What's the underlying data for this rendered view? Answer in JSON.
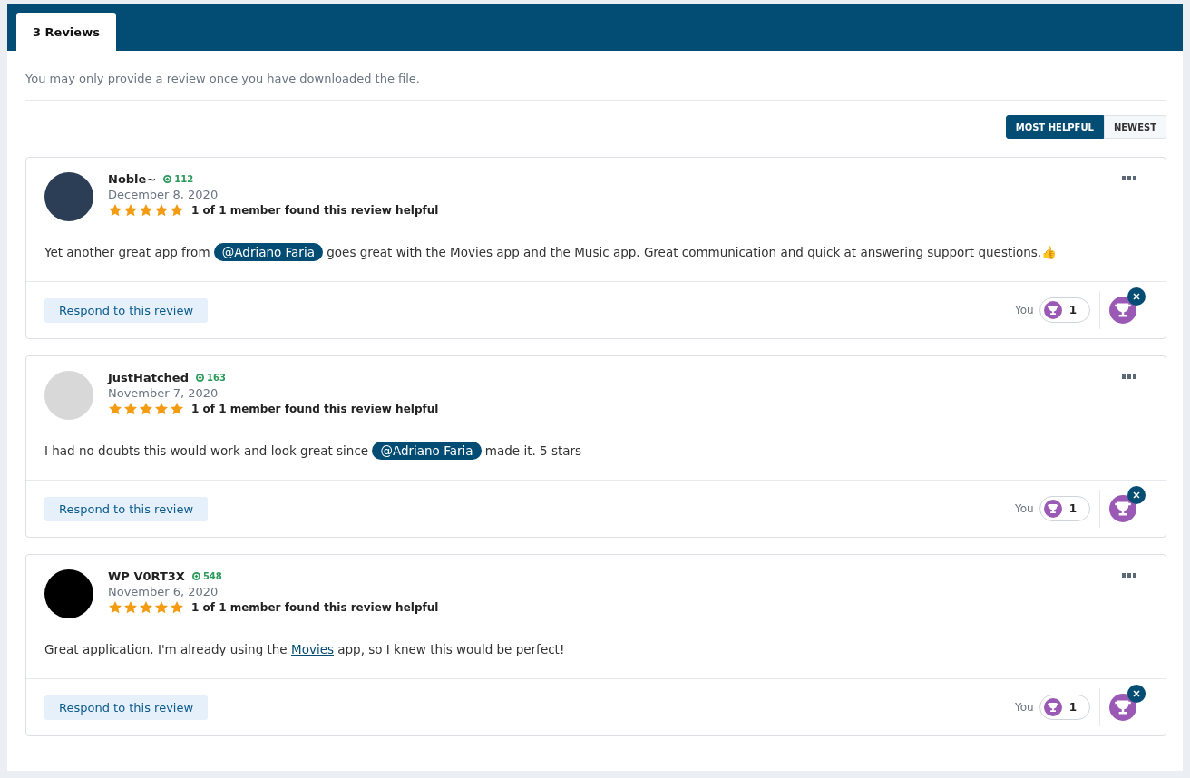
{
  "tabs": [
    {
      "label": "3 Reviews",
      "selected": true
    }
  ],
  "notice": "You may only provide a review once you have downloaded the file.",
  "sort": [
    {
      "label": "MOST HELPFUL",
      "selected": true
    },
    {
      "label": "NEWEST",
      "selected": false
    }
  ],
  "reviews": [
    {
      "author": "Noble~",
      "reputation": "112",
      "date": "December 8, 2020",
      "stars": 5,
      "helpful": "1 of 1 member found this review helpful",
      "body": [
        {
          "kind": "text",
          "text": "Yet another great app from "
        },
        {
          "kind": "mention",
          "text": "@Adriano Faria"
        },
        {
          "kind": "text",
          "text": " goes great with the Movies app and the Music app. Great communication and quick at answering support questions.👍"
        }
      ],
      "respond": "Respond to this review",
      "reactor": "You",
      "reaction_count": "1"
    },
    {
      "author": "JustHatched",
      "reputation": "163",
      "date": "November 7, 2020",
      "stars": 5,
      "helpful": "1 of 1 member found this review helpful",
      "body": [
        {
          "kind": "text",
          "text": "I had no doubts this would work and look great since "
        },
        {
          "kind": "mention",
          "text": "@Adriano Faria"
        },
        {
          "kind": "text",
          "text": " made it. 5 stars"
        }
      ],
      "respond": "Respond to this review",
      "reactor": "You",
      "reaction_count": "1"
    },
    {
      "author": "WP V0RT3X",
      "reputation": "548",
      "date": "November 6, 2020",
      "stars": 5,
      "helpful": "1 of 1 member found this review helpful",
      "body": [
        {
          "kind": "text",
          "text": "Great application. I'm already using the "
        },
        {
          "kind": "link",
          "text": "Movies"
        },
        {
          "kind": "text",
          "text": " app, so I knew this would be perfect!"
        }
      ],
      "respond": "Respond to this review",
      "reactor": "You",
      "reaction_count": "1"
    }
  ]
}
